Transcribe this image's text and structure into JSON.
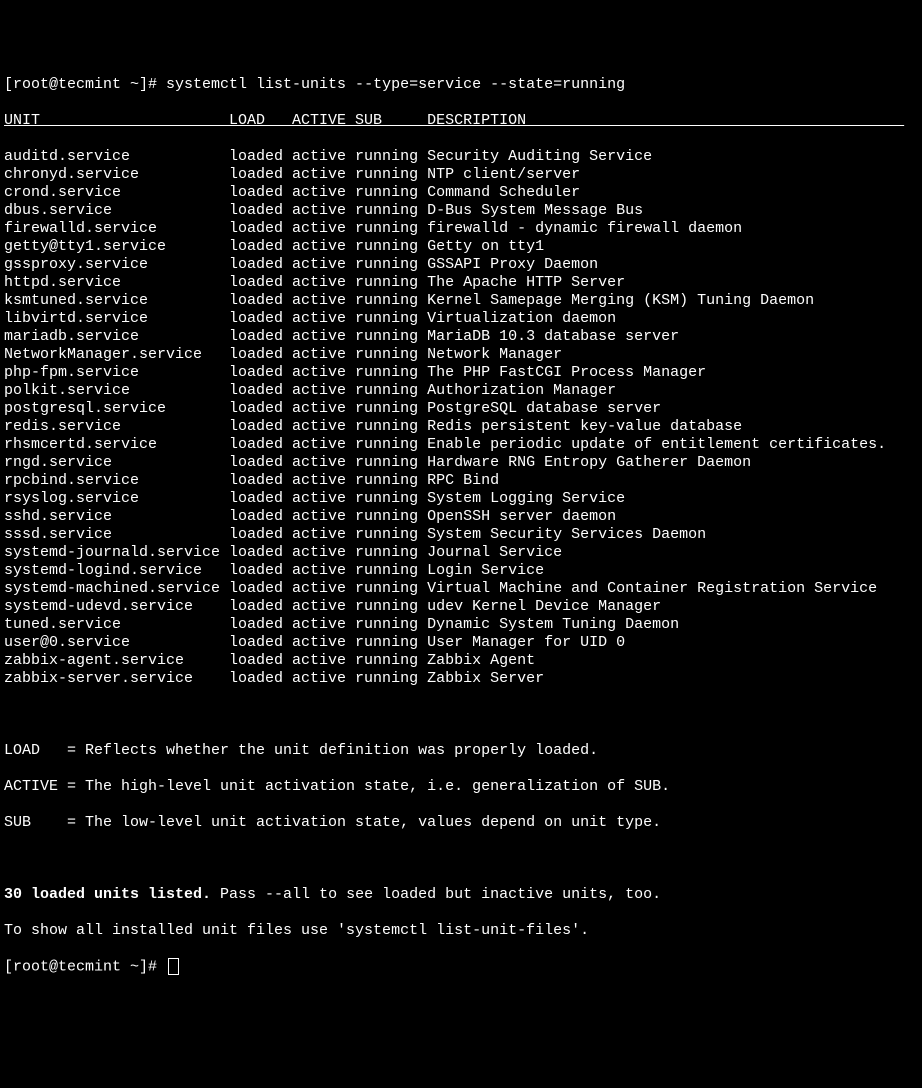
{
  "prompt": {
    "prefix": "[root@tecmint ~]# ",
    "command": "systemctl list-units --type=service --state=running"
  },
  "header": {
    "unit": "UNIT",
    "load": "LOAD",
    "active": "ACTIVE",
    "sub": "SUB",
    "description": "DESCRIPTION"
  },
  "units": [
    {
      "unit": "auditd.service",
      "load": "loaded",
      "active": "active",
      "sub": "running",
      "desc": "Security Auditing Service"
    },
    {
      "unit": "chronyd.service",
      "load": "loaded",
      "active": "active",
      "sub": "running",
      "desc": "NTP client/server"
    },
    {
      "unit": "crond.service",
      "load": "loaded",
      "active": "active",
      "sub": "running",
      "desc": "Command Scheduler"
    },
    {
      "unit": "dbus.service",
      "load": "loaded",
      "active": "active",
      "sub": "running",
      "desc": "D-Bus System Message Bus"
    },
    {
      "unit": "firewalld.service",
      "load": "loaded",
      "active": "active",
      "sub": "running",
      "desc": "firewalld - dynamic firewall daemon"
    },
    {
      "unit": "getty@tty1.service",
      "load": "loaded",
      "active": "active",
      "sub": "running",
      "desc": "Getty on tty1"
    },
    {
      "unit": "gssproxy.service",
      "load": "loaded",
      "active": "active",
      "sub": "running",
      "desc": "GSSAPI Proxy Daemon"
    },
    {
      "unit": "httpd.service",
      "load": "loaded",
      "active": "active",
      "sub": "running",
      "desc": "The Apache HTTP Server"
    },
    {
      "unit": "ksmtuned.service",
      "load": "loaded",
      "active": "active",
      "sub": "running",
      "desc": "Kernel Samepage Merging (KSM) Tuning Daemon"
    },
    {
      "unit": "libvirtd.service",
      "load": "loaded",
      "active": "active",
      "sub": "running",
      "desc": "Virtualization daemon"
    },
    {
      "unit": "mariadb.service",
      "load": "loaded",
      "active": "active",
      "sub": "running",
      "desc": "MariaDB 10.3 database server"
    },
    {
      "unit": "NetworkManager.service",
      "load": "loaded",
      "active": "active",
      "sub": "running",
      "desc": "Network Manager"
    },
    {
      "unit": "php-fpm.service",
      "load": "loaded",
      "active": "active",
      "sub": "running",
      "desc": "The PHP FastCGI Process Manager"
    },
    {
      "unit": "polkit.service",
      "load": "loaded",
      "active": "active",
      "sub": "running",
      "desc": "Authorization Manager"
    },
    {
      "unit": "postgresql.service",
      "load": "loaded",
      "active": "active",
      "sub": "running",
      "desc": "PostgreSQL database server"
    },
    {
      "unit": "redis.service",
      "load": "loaded",
      "active": "active",
      "sub": "running",
      "desc": "Redis persistent key-value database"
    },
    {
      "unit": "rhsmcertd.service",
      "load": "loaded",
      "active": "active",
      "sub": "running",
      "desc": "Enable periodic update of entitlement certificates."
    },
    {
      "unit": "rngd.service",
      "load": "loaded",
      "active": "active",
      "sub": "running",
      "desc": "Hardware RNG Entropy Gatherer Daemon"
    },
    {
      "unit": "rpcbind.service",
      "load": "loaded",
      "active": "active",
      "sub": "running",
      "desc": "RPC Bind"
    },
    {
      "unit": "rsyslog.service",
      "load": "loaded",
      "active": "active",
      "sub": "running",
      "desc": "System Logging Service"
    },
    {
      "unit": "sshd.service",
      "load": "loaded",
      "active": "active",
      "sub": "running",
      "desc": "OpenSSH server daemon"
    },
    {
      "unit": "sssd.service",
      "load": "loaded",
      "active": "active",
      "sub": "running",
      "desc": "System Security Services Daemon"
    },
    {
      "unit": "systemd-journald.service",
      "load": "loaded",
      "active": "active",
      "sub": "running",
      "desc": "Journal Service"
    },
    {
      "unit": "systemd-logind.service",
      "load": "loaded",
      "active": "active",
      "sub": "running",
      "desc": "Login Service"
    },
    {
      "unit": "systemd-machined.service",
      "load": "loaded",
      "active": "active",
      "sub": "running",
      "desc": "Virtual Machine and Container Registration Service"
    },
    {
      "unit": "systemd-udevd.service",
      "load": "loaded",
      "active": "active",
      "sub": "running",
      "desc": "udev Kernel Device Manager"
    },
    {
      "unit": "tuned.service",
      "load": "loaded",
      "active": "active",
      "sub": "running",
      "desc": "Dynamic System Tuning Daemon"
    },
    {
      "unit": "user@0.service",
      "load": "loaded",
      "active": "active",
      "sub": "running",
      "desc": "User Manager for UID 0"
    },
    {
      "unit": "zabbix-agent.service",
      "load": "loaded",
      "active": "active",
      "sub": "running",
      "desc": "Zabbix Agent"
    },
    {
      "unit": "zabbix-server.service",
      "load": "loaded",
      "active": "active",
      "sub": "running",
      "desc": "Zabbix Server"
    }
  ],
  "legend": {
    "load": "LOAD   = Reflects whether the unit definition was properly loaded.",
    "active": "ACTIVE = The high-level unit activation state, i.e. generalization of SUB.",
    "sub": "SUB    = The low-level unit activation state, values depend on unit type."
  },
  "footer": {
    "count_bold": "30 loaded units listed.",
    "count_rest": " Pass --all to see loaded but inactive units, too.",
    "hint": "To show all installed unit files use 'systemctl list-unit-files'."
  },
  "prompt2": "[root@tecmint ~]# "
}
